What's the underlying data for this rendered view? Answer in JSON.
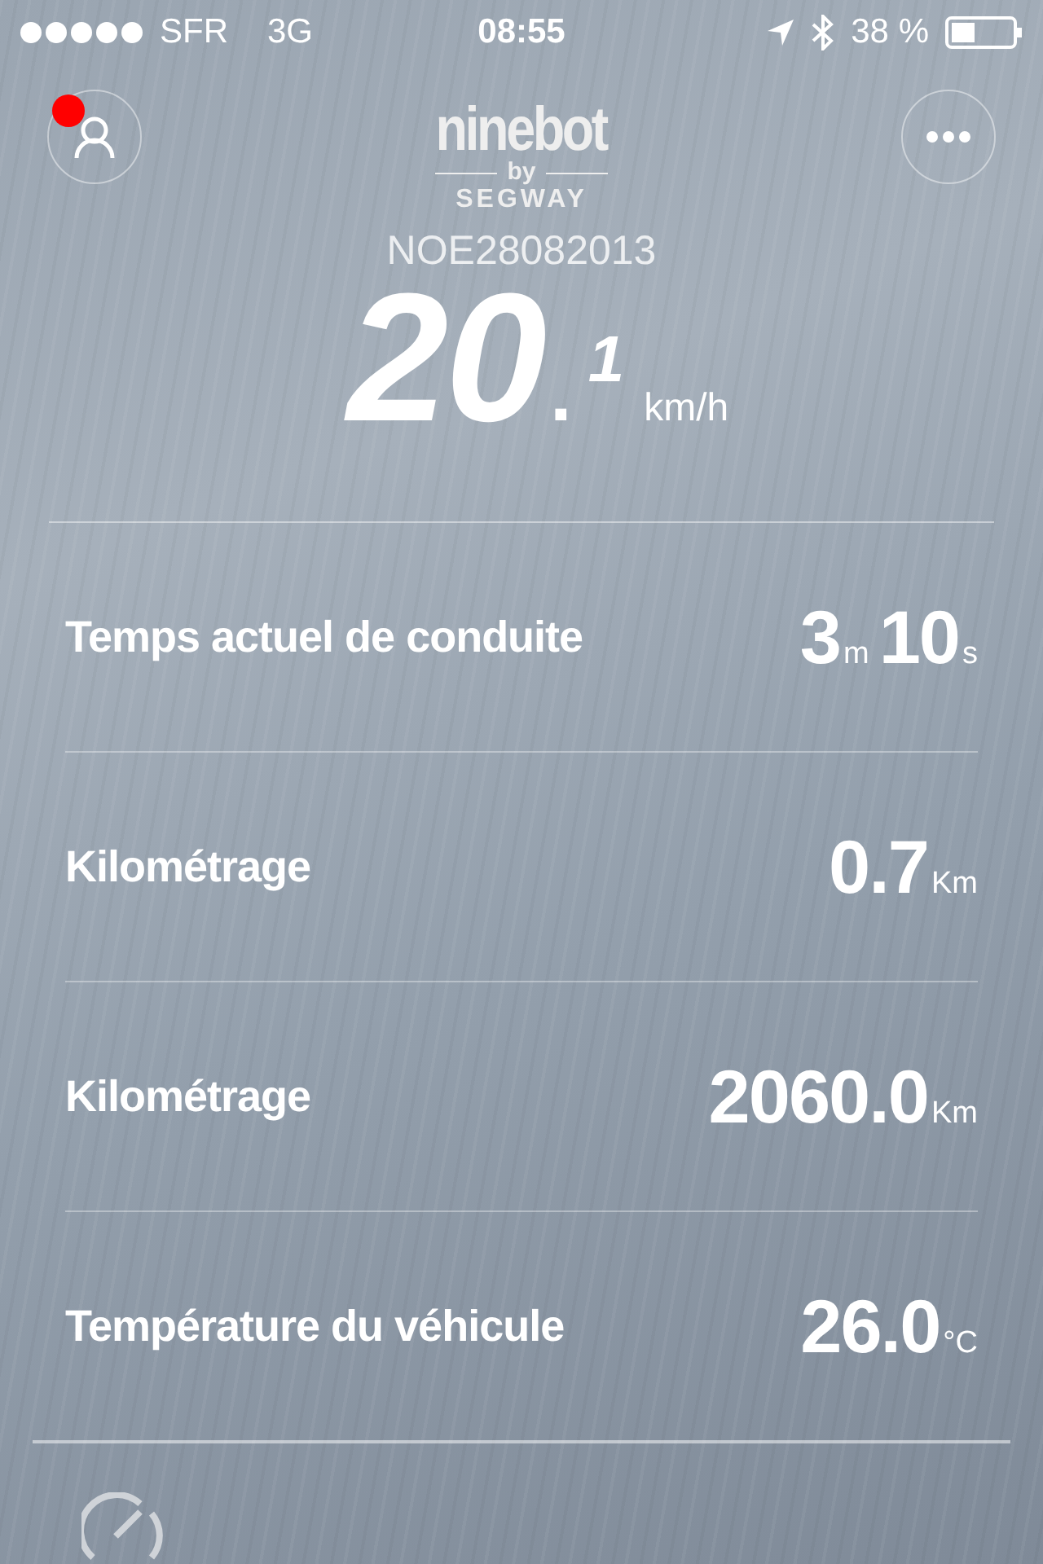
{
  "status_bar": {
    "carrier": "SFR",
    "network": "3G",
    "time": "08:55",
    "battery": "38 %"
  },
  "header": {
    "profile_notification": true,
    "logo": {
      "brand": "ninebot",
      "by": "by",
      "maker": "SEGWAY"
    }
  },
  "device_name": "NOE28082013",
  "speed": {
    "integer": "20",
    "decimal": ".",
    "fraction": "1",
    "unit": "km/h"
  },
  "stats": [
    {
      "label": "Temps actuel de conduite",
      "value": [
        {
          "kind": "number",
          "text": "3"
        },
        {
          "kind": "unit",
          "text": "m"
        },
        {
          "kind": "number",
          "text": "10"
        },
        {
          "kind": "unit",
          "text": "s"
        }
      ]
    },
    {
      "label": "Kilométrage",
      "value": [
        {
          "kind": "number",
          "text": "0.7"
        },
        {
          "kind": "unit",
          "text": "Km"
        }
      ]
    },
    {
      "label": "Kilométrage",
      "value": [
        {
          "kind": "number",
          "text": "2060.0"
        },
        {
          "kind": "unit",
          "text": "Km"
        }
      ]
    },
    {
      "label": "Température du véhicule",
      "value": [
        {
          "kind": "number",
          "text": "26.0"
        },
        {
          "kind": "unit",
          "text": "°C"
        }
      ]
    }
  ]
}
